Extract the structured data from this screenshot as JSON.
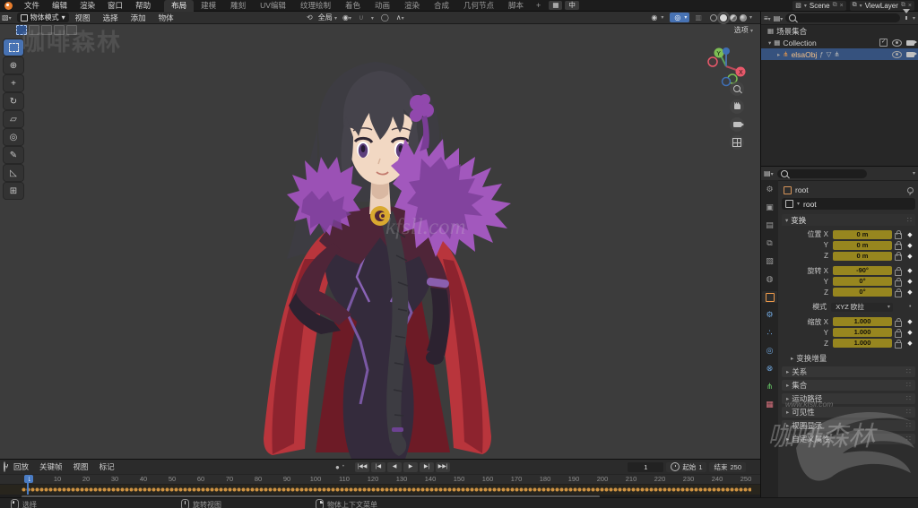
{
  "topbar": {
    "menus": [
      "文件",
      "编辑",
      "渲染",
      "窗口",
      "帮助"
    ],
    "workspaces": [
      {
        "label": "布局",
        "active": true
      },
      {
        "label": "建模"
      },
      {
        "label": "雕刻"
      },
      {
        "label": "UV编辑"
      },
      {
        "label": "纹理绘制"
      },
      {
        "label": "着色"
      },
      {
        "label": "动画"
      },
      {
        "label": "渲染"
      },
      {
        "label": "合成"
      },
      {
        "label": "几何节点"
      },
      {
        "label": "脚本"
      }
    ],
    "add_workspace": "+",
    "lang_button": "中",
    "scene_name": "Scene",
    "view_layer_name": "ViewLayer"
  },
  "viewport_header": {
    "mode": "物体模式",
    "menus": [
      "视图",
      "选择",
      "添加",
      "物体"
    ],
    "orientation": "全局",
    "options": "选项"
  },
  "toolbar_tools": [
    {
      "id": "select-box",
      "glyph": "",
      "active": true
    },
    {
      "id": "cursor",
      "glyph": "⊕"
    },
    {
      "id": "move",
      "glyph": "+"
    },
    {
      "id": "rotate",
      "glyph": "↻"
    },
    {
      "id": "scale",
      "glyph": "▱"
    },
    {
      "id": "transform",
      "glyph": "◎"
    },
    {
      "id": "annotate",
      "glyph": "✎"
    },
    {
      "id": "measure",
      "glyph": "◺"
    },
    {
      "id": "add-cube",
      "glyph": "⊞"
    }
  ],
  "outliner": {
    "scene_collection": "场景集合",
    "collection": "Collection",
    "object_name": "elsaObj",
    "object_badges": [
      "ƒ",
      "▽",
      "⋔"
    ]
  },
  "properties": {
    "breadcrumb": "root",
    "name_field": "root",
    "transform": {
      "title": "变换",
      "rows": [
        {
          "label": "位置 X",
          "value": "0 m",
          "kind": "anim"
        },
        {
          "label": "Y",
          "value": "0 m",
          "kind": "anim"
        },
        {
          "label": "Z",
          "value": "0 m",
          "kind": "anim"
        },
        {
          "label": "旋转 X",
          "value": "-90°",
          "kind": "anim",
          "gap": true
        },
        {
          "label": "Y",
          "value": "0°",
          "kind": "anim"
        },
        {
          "label": "Z",
          "value": "0°",
          "kind": "anim"
        },
        {
          "label": "模式",
          "value": "XYZ 欧拉",
          "kind": "dropdown",
          "gap": true
        },
        {
          "label": "缩放 X",
          "value": "1.000",
          "kind": "anim",
          "gap": true
        },
        {
          "label": "Y",
          "value": "1.000",
          "kind": "anim"
        },
        {
          "label": "Z",
          "value": "1.000",
          "kind": "anim"
        }
      ],
      "subpanel": "变换增量"
    },
    "sections": [
      {
        "label": "关系"
      },
      {
        "label": "集合"
      },
      {
        "label": "运动路径"
      },
      {
        "label": "可见性"
      },
      {
        "label": "视图显示"
      },
      {
        "label": "自定义属性"
      }
    ],
    "tabs": [
      {
        "id": "tool",
        "glyph": "⚙",
        "color": "#9a9a9a"
      },
      {
        "id": "render",
        "glyph": "▣",
        "color": "#9a9a9a"
      },
      {
        "id": "output",
        "glyph": "▤",
        "color": "#9a9a9a"
      },
      {
        "id": "view-layer",
        "glyph": "⧉",
        "color": "#9a9a9a"
      },
      {
        "id": "scene",
        "glyph": "▧",
        "color": "#9a9a9a"
      },
      {
        "id": "world",
        "glyph": "◍",
        "color": "#9a9a9a"
      },
      {
        "id": "object",
        "glyph": "",
        "color": "#ee9a4a",
        "active": true
      },
      {
        "id": "modifiers",
        "glyph": "⚙",
        "color": "#71a8e0"
      },
      {
        "id": "particles",
        "glyph": "∴",
        "color": "#71a8e0"
      },
      {
        "id": "physics",
        "glyph": "◎",
        "color": "#71a8e0"
      },
      {
        "id": "constraints",
        "glyph": "⊗",
        "color": "#71a8e0"
      },
      {
        "id": "object-data",
        "glyph": "⋔",
        "color": "#67c967"
      },
      {
        "id": "texture",
        "glyph": "▦",
        "color": "#d6707c"
      }
    ]
  },
  "timeline": {
    "menus": [
      "回放",
      "关键帧",
      "视图",
      "标记"
    ],
    "frames": [
      {
        "n": "1",
        "current": true
      },
      {
        "n": "10"
      },
      {
        "n": "20"
      },
      {
        "n": "30"
      },
      {
        "n": "40"
      },
      {
        "n": "50"
      },
      {
        "n": "60"
      },
      {
        "n": "70"
      },
      {
        "n": "80"
      },
      {
        "n": "90"
      },
      {
        "n": "100"
      },
      {
        "n": "110"
      },
      {
        "n": "120"
      },
      {
        "n": "130"
      },
      {
        "n": "140"
      },
      {
        "n": "150"
      },
      {
        "n": "160"
      },
      {
        "n": "170"
      },
      {
        "n": "180"
      },
      {
        "n": "190"
      },
      {
        "n": "200"
      },
      {
        "n": "210"
      },
      {
        "n": "220"
      },
      {
        "n": "230"
      },
      {
        "n": "240"
      },
      {
        "n": "250"
      }
    ],
    "current_frame": "1",
    "start_label": "起始",
    "start_value": "1",
    "end_label": "结束",
    "end_value": "250"
  },
  "statusbar": {
    "items": [
      {
        "btn": "left",
        "label": "选择"
      },
      {
        "btn": "middle",
        "label": "旋转视图"
      },
      {
        "btn": "right",
        "label": "物体上下文菜单"
      }
    ]
  },
  "watermarks": {
    "top_left": "咖啡森林",
    "center": "kfsll.com",
    "bottom_site": "www.kfsll.com",
    "bottom_logo": "咖啡森林"
  },
  "colors": {
    "selection_blue": "#4772b3",
    "animated_field_yellow": "#97861f",
    "keyframe_orange": "#d79843",
    "outliner_select": "#36527e",
    "cape_red": "#b9353c",
    "boa_purple": "#a258bd"
  }
}
